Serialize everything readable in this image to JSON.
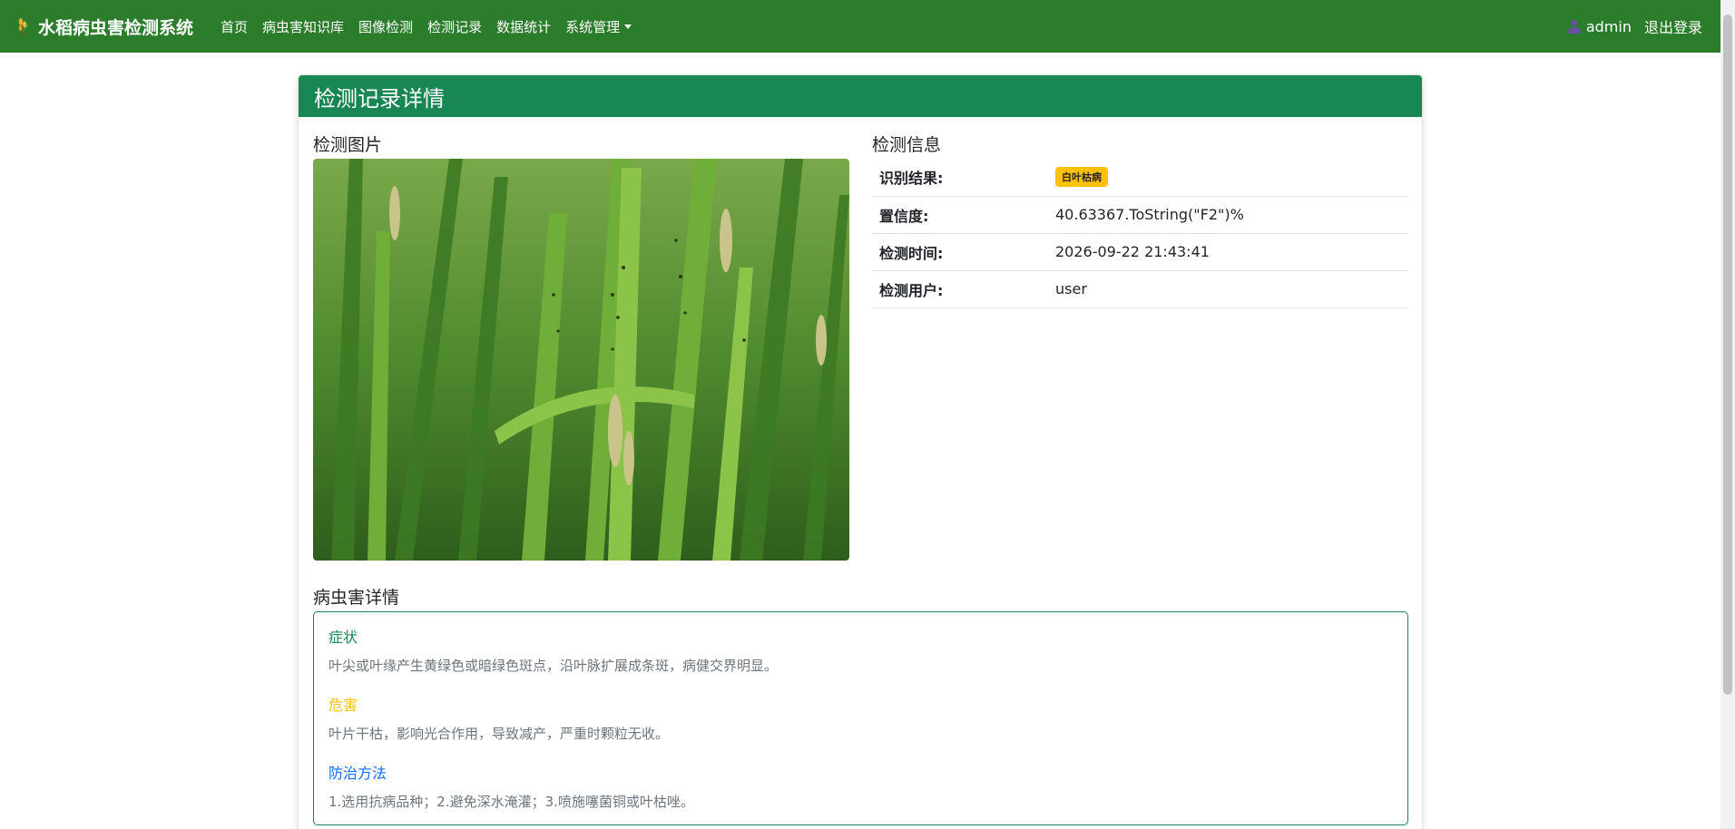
{
  "navbar": {
    "brand": "水稻病虫害检测系统",
    "items": [
      "首页",
      "病虫害知识库",
      "图像检测",
      "检测记录",
      "数据统计"
    ],
    "dropdown_label": "系统管理",
    "username": "admin",
    "logout": "退出登录",
    "color": "#2b7d2b"
  },
  "card": {
    "title": "检测记录详情",
    "image_section_title": "检测图片",
    "info_section_title": "检测信息",
    "info_rows": [
      {
        "label": "识别结果:",
        "value": "白叶枯病",
        "badge": true
      },
      {
        "label": "置信度:",
        "value": "40.63367.ToString(\"F2\")%"
      },
      {
        "label": "检测时间:",
        "value": "2026-09-22 21:43:41"
      },
      {
        "label": "检测用户:",
        "value": "user"
      }
    ],
    "detail_section_title": "病虫害详情",
    "details": {
      "symptom_title": "症状",
      "symptom_text": "叶尖或叶缘产生黄绿色或暗绿色斑点，沿叶脉扩展成条斑，病健交界明显。",
      "harm_title": "危害",
      "harm_text": "叶片干枯，影响光合作用，导致减产，严重时颗粒无收。",
      "control_title": "防治方法",
      "control_text": "1.选用抗病品种；2.避免深水淹灌；3.喷施噻菌铜或叶枯唑。"
    },
    "accent": "#198754"
  }
}
